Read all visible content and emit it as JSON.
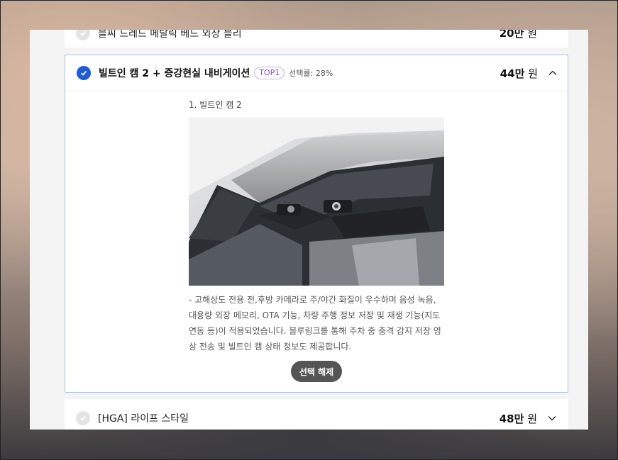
{
  "options": {
    "top_partial": {
      "label": "블씨 드레드 메탈릭 베드 외장 블리",
      "price_num": "20만",
      "price_unit": " 원"
    },
    "expanded": {
      "title": "빌트인 캠 2 + 증강현실 내비게이션",
      "badge": "TOP1",
      "selection_rate": "선택률: 28%",
      "price_num": "44만",
      "price_unit": " 원",
      "item_title": "1. 빌트인 캠 2",
      "description": "- 고해상도 전용 전,후방 카메라로 주/야간 화질이 우수하며 음성 녹음, 대용량 외장 메모리, OTA 기능, 차량 주행 정보 저장 및 재생 기능(지도 연동 등)이 적용되었습니다. 블루링크를 통해 주차 중 충격 감지 저장 영상 전송 및 빌트인 캠 상태 정보도 제공합니다.",
      "deselect_label": "선택 해제"
    },
    "bottom": {
      "label": "[HGA] 라이프 스타일",
      "price_num": "48만",
      "price_unit": " 원"
    }
  },
  "colors": {
    "accent": "#1f5ad8",
    "badge": "#7d4fd2",
    "border": "#a9bde6",
    "button": "#555555"
  }
}
